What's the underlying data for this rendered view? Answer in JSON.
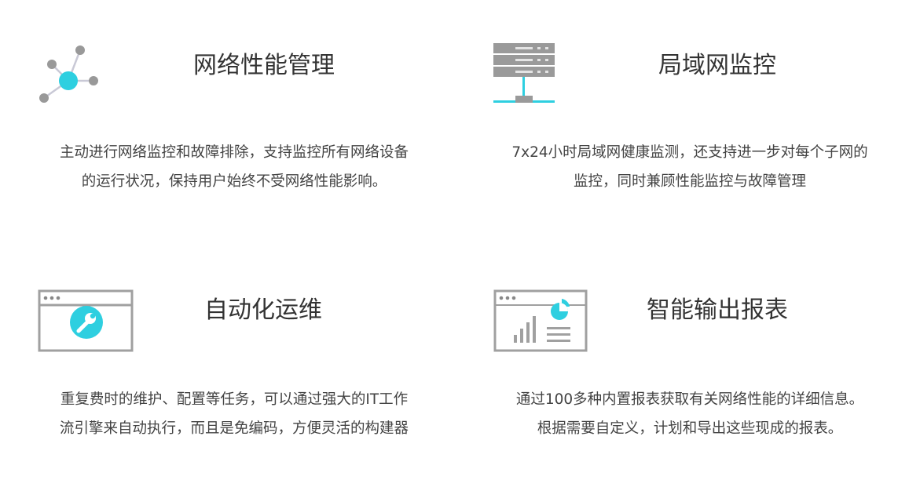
{
  "colors": {
    "accent": "#2ecfe0",
    "icon_gray": "#9a9a9a",
    "text": "#444444",
    "title": "#333333"
  },
  "features": [
    {
      "icon": "network-nodes-icon",
      "title": "网络性能管理",
      "desc_line1": "主动进行网络监控和故障排除，支持监控所有网络设备",
      "desc_line2": "的运行状况，保持用户始终不受网络性能影响。"
    },
    {
      "icon": "server-rack-icon",
      "title": "局域网监控",
      "desc_line1": "7x24小时局域网健康监测，还支持进一步对每个子网的",
      "desc_line2": "监控，同时兼顾性能监控与故障管理"
    },
    {
      "icon": "wrench-window-icon",
      "title": "自动化运维",
      "desc_line1": "重复费时的维护、配置等任务，可以通过强大的IT工作",
      "desc_line2": "流引擎来自动执行，而且是免编码，方便灵活的构建器"
    },
    {
      "icon": "report-chart-icon",
      "title": "智能输出报表",
      "desc_line1": "通过100多种内置报表获取有关网络性能的详细信息。",
      "desc_line2": "根据需要自定义，计划和导出这些现成的报表。"
    }
  ]
}
